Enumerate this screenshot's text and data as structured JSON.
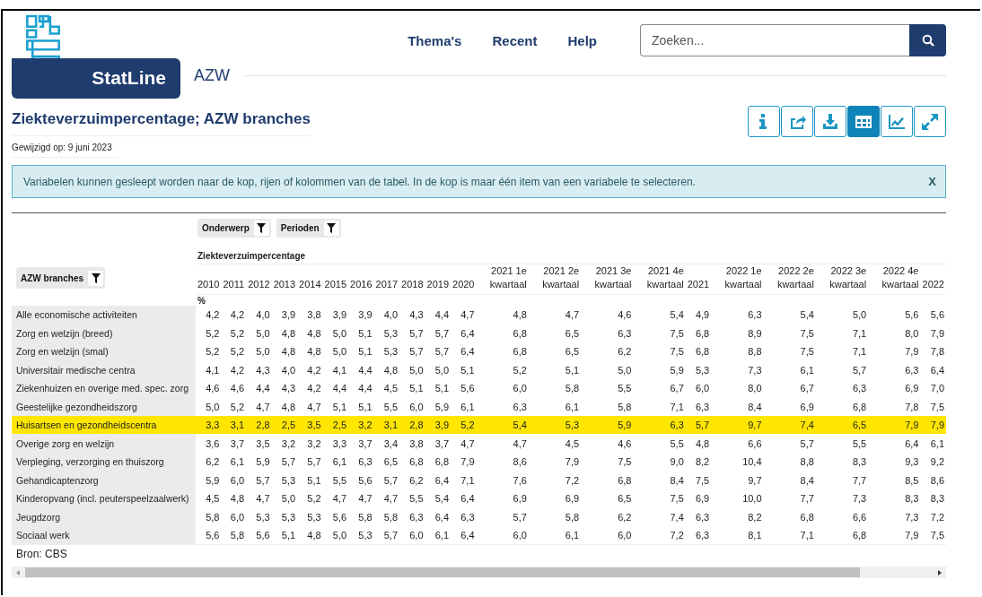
{
  "header": {
    "brand": "StatLine",
    "section": "AZW",
    "nav": [
      "Thema's",
      "Recent",
      "Help"
    ],
    "search": {
      "placeholder": "Zoeken..."
    }
  },
  "title": "Ziekteverzuimpercentage; AZW branches",
  "modified": "Gewijzigd op: 9 juni 2023",
  "view_buttons": [
    {
      "kind": "info",
      "selected": false
    },
    {
      "kind": "share",
      "selected": false
    },
    {
      "kind": "download",
      "selected": false
    },
    {
      "kind": "table",
      "selected": true
    },
    {
      "kind": "chart",
      "selected": false
    },
    {
      "kind": "expand",
      "selected": false
    }
  ],
  "notice": {
    "text": "Variabelen kunnen gesleept worden naar de kop, rijen of kolommen van de tabel. In de kop is maar één item van een variabele te selecteren.",
    "close": "X"
  },
  "table": {
    "column_variables": [
      "Onderwerp",
      "Perioden"
    ],
    "row_variable": "AZW branches",
    "topic": "Ziekteverzuimpercentage",
    "unit": "%",
    "columns": [
      "2010",
      "2011",
      "2012",
      "2013",
      "2014",
      "2015",
      "2016",
      "2017",
      "2018",
      "2019",
      "2020",
      "2021 1e kwartaal",
      "2021 2e kwartaal",
      "2021 3e kwartaal",
      "2021 4e kwartaal",
      "2021",
      "2022 1e kwartaal",
      "2022 2e kwartaal",
      "2022 3e kwartaal",
      "2022 4e kwartaal",
      "2022"
    ],
    "rows": [
      {
        "label": "Alle economische activiteiten",
        "highlighted": false,
        "values": [
          "4,2",
          "4,2",
          "4,0",
          "3,9",
          "3,8",
          "3,9",
          "3,9",
          "4,0",
          "4,3",
          "4,4",
          "4,7",
          "4,8",
          "4,7",
          "4,6",
          "5,4",
          "4,9",
          "6,3",
          "5,4",
          "5,0",
          "5,6",
          "5,6"
        ]
      },
      {
        "label": "Zorg en welzijn (breed)",
        "highlighted": false,
        "values": [
          "5,2",
          "5,2",
          "5,0",
          "4,8",
          "4,8",
          "5,0",
          "5,1",
          "5,3",
          "5,7",
          "5,7",
          "6,4",
          "6,8",
          "6,5",
          "6,3",
          "7,5",
          "6,8",
          "8,9",
          "7,5",
          "7,1",
          "8,0",
          "7,9"
        ]
      },
      {
        "label": "Zorg en welzijn (smal)",
        "highlighted": false,
        "values": [
          "5,2",
          "5,2",
          "5,0",
          "4,8",
          "4,8",
          "5,0",
          "5,1",
          "5,3",
          "5,7",
          "5,7",
          "6,4",
          "6,8",
          "6,5",
          "6,2",
          "7,5",
          "6,8",
          "8,8",
          "7,5",
          "7,1",
          "7,9",
          "7,8"
        ]
      },
      {
        "label": "Universitair medische centra",
        "highlighted": false,
        "values": [
          "4,1",
          "4,2",
          "4,3",
          "4,0",
          "4,2",
          "4,1",
          "4,4",
          "4,8",
          "5,0",
          "5,0",
          "5,1",
          "5,2",
          "5,1",
          "5,0",
          "5,9",
          "5,3",
          "7,3",
          "6,1",
          "5,7",
          "6,3",
          "6,4"
        ]
      },
      {
        "label": "Ziekenhuizen en overige med. spec. zorg",
        "highlighted": false,
        "values": [
          "4,6",
          "4,6",
          "4,4",
          "4,3",
          "4,2",
          "4,4",
          "4,4",
          "4,5",
          "5,1",
          "5,1",
          "5,6",
          "6,0",
          "5,8",
          "5,5",
          "6,7",
          "6,0",
          "8,0",
          "6,7",
          "6,3",
          "6,9",
          "7,0"
        ]
      },
      {
        "label": "Geestelijke gezondheidszorg",
        "highlighted": false,
        "values": [
          "5,0",
          "5,2",
          "4,7",
          "4,8",
          "4,7",
          "5,1",
          "5,1",
          "5,5",
          "6,0",
          "5,9",
          "6,1",
          "6,3",
          "6,1",
          "5,8",
          "7,1",
          "6,3",
          "8,4",
          "6,9",
          "6,8",
          "7,8",
          "7,5"
        ]
      },
      {
        "label": "Huisartsen en gezondheidscentra",
        "highlighted": true,
        "values": [
          "3,3",
          "3,1",
          "2,8",
          "2,5",
          "3,5",
          "2,5",
          "3,2",
          "3,1",
          "2,8",
          "3,9",
          "5,2",
          "5,4",
          "5,3",
          "5,9",
          "6,3",
          "5,7",
          "9,7",
          "7,4",
          "6,5",
          "7,9",
          "7,9"
        ]
      },
      {
        "label": "Overige zorg en welzijn",
        "highlighted": false,
        "values": [
          "3,6",
          "3,7",
          "3,5",
          "3,2",
          "3,2",
          "3,3",
          "3,7",
          "3,4",
          "3,8",
          "3,7",
          "4,7",
          "4,7",
          "4,5",
          "4,6",
          "5,5",
          "4,8",
          "6,6",
          "5,7",
          "5,5",
          "6,4",
          "6,1"
        ]
      },
      {
        "label": "Verpleging, verzorging en thuiszorg",
        "highlighted": false,
        "values": [
          "6,2",
          "6,1",
          "5,9",
          "5,7",
          "5,7",
          "6,1",
          "6,3",
          "6,5",
          "6,8",
          "6,8",
          "7,9",
          "8,6",
          "7,9",
          "7,5",
          "9,0",
          "8,2",
          "10,4",
          "8,8",
          "8,3",
          "9,3",
          "9,2"
        ]
      },
      {
        "label": "Gehandicaptenzorg",
        "highlighted": false,
        "values": [
          "5,9",
          "6,0",
          "5,7",
          "5,3",
          "5,1",
          "5,5",
          "5,6",
          "5,7",
          "6,2",
          "6,4",
          "7,1",
          "7,6",
          "7,2",
          "6,8",
          "8,4",
          "7,5",
          "9,7",
          "8,4",
          "7,7",
          "8,5",
          "8,6"
        ]
      },
      {
        "label": "Kinderopvang (incl. peuterspeelzaalwerk)",
        "highlighted": false,
        "values": [
          "4,5",
          "4,8",
          "4,7",
          "5,0",
          "5,2",
          "4,7",
          "4,7",
          "4,7",
          "5,5",
          "5,4",
          "6,4",
          "6,9",
          "6,9",
          "6,5",
          "7,5",
          "6,9",
          "10,0",
          "7,7",
          "7,3",
          "8,3",
          "8,3"
        ]
      },
      {
        "label": "Jeugdzorg",
        "highlighted": false,
        "values": [
          "5,8",
          "6,0",
          "5,3",
          "5,3",
          "5,3",
          "5,6",
          "5,8",
          "5,8",
          "6,3",
          "6,4",
          "6,3",
          "5,7",
          "5,8",
          "6,2",
          "7,4",
          "6,3",
          "8,2",
          "6,8",
          "6,6",
          "7,3",
          "7,2"
        ]
      },
      {
        "label": "Sociaal werk",
        "highlighted": false,
        "values": [
          "5,6",
          "5,8",
          "5,6",
          "5,1",
          "4,8",
          "5,0",
          "5,3",
          "5,7",
          "6,0",
          "6,1",
          "6,4",
          "6,0",
          "6,1",
          "6,0",
          "7,2",
          "6,3",
          "8,1",
          "7,1",
          "6,8",
          "7,9",
          "7,5"
        ]
      }
    ]
  },
  "source": "Bron: CBS"
}
